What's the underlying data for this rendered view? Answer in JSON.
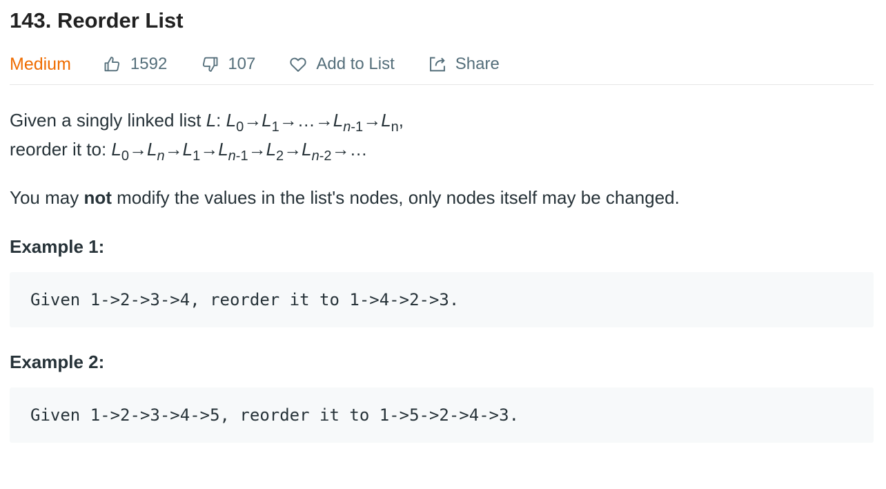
{
  "problem": {
    "title": "143. Reorder List",
    "difficulty": "Medium",
    "likes": "1592",
    "dislikes": "107",
    "add_to_list_label": "Add to List",
    "share_label": "Share"
  },
  "description": {
    "line1_prefix": "Given a singly linked list ",
    "line2_prefix": "reorder it to: ",
    "note_before": "You may ",
    "note_bold": "not",
    "note_after": " modify the values in the list's nodes, only nodes itself may be changed."
  },
  "examples": [
    {
      "title": "Example 1:",
      "code": "Given 1->2->3->4, reorder it to 1->4->2->3."
    },
    {
      "title": "Example 2:",
      "code": "Given 1->2->3->4->5, reorder it to 1->5->2->4->3."
    }
  ],
  "colors": {
    "difficulty_medium": "#ef6c00",
    "meta_text": "#546e7a",
    "code_background": "#f7f9fa"
  },
  "icons": {
    "like": "thumbs-up-icon",
    "dislike": "thumbs-down-icon",
    "add_to_list": "heart-icon",
    "share": "share-icon"
  }
}
